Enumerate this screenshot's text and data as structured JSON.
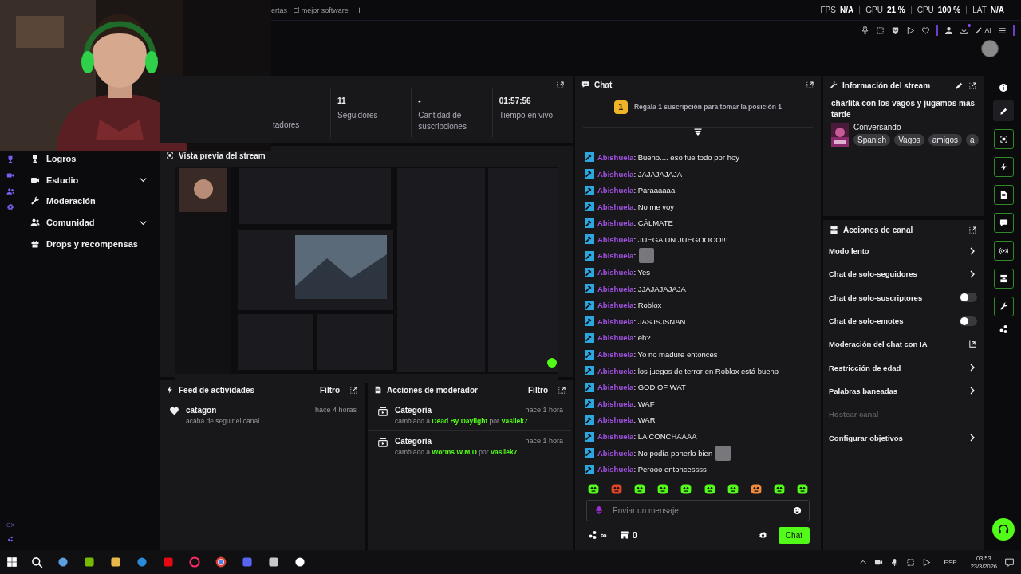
{
  "browser": {
    "tab_title": "ertas | El mejor software",
    "new_tab": "+"
  },
  "perf": [
    {
      "label": "FPS",
      "value": "N/A"
    },
    {
      "label": "GPU",
      "value": "21 %"
    },
    {
      "label": "CPU",
      "value": "100 %"
    },
    {
      "label": "LAT",
      "value": "N/A"
    }
  ],
  "toolbar": {
    "ai_label": "AI"
  },
  "left_nav": {
    "items": [
      {
        "label": "Logros",
        "expandable": false
      },
      {
        "label": "Estudio",
        "expandable": true
      },
      {
        "label": "Moderación",
        "expandable": false
      },
      {
        "label": "Comunidad",
        "expandable": true
      },
      {
        "label": "Drops y recompensas",
        "expandable": false
      }
    ],
    "footer_label": "GX"
  },
  "stats": [
    {
      "label": "tadores"
    },
    {
      "value": "11",
      "label": "Seguidores"
    },
    {
      "value": "-",
      "label": "Cantidad de suscripciones"
    },
    {
      "value": "01:57:56",
      "label": "Tiempo en vivo"
    }
  ],
  "preview": {
    "title": "Vista previa del stream"
  },
  "activity_feed": {
    "title": "Feed de actividades",
    "filter": "Filtro",
    "items": [
      {
        "user": "catagon",
        "time": "hace 4 horas",
        "detail": "acaba de seguir el canal"
      }
    ]
  },
  "mod_actions": {
    "title": "Acciones de moderador",
    "filter": "Filtro",
    "items": [
      {
        "title": "Categoría",
        "time": "hace 1 hora",
        "detail": "cambiado a **Dead By Daylight** por **Vasilek7**"
      },
      {
        "title": "Categoría",
        "time": "hace 1 hora",
        "detail": "cambiado a **Worms W.M.D** por **Vasilek7**"
      }
    ]
  },
  "chat": {
    "title": "Chat",
    "banner_rank": "1",
    "banner": "Regala 1 suscripción para tomar la posición 1",
    "messages": [
      {
        "user": "Abishuela",
        "text": ": Bueno.... eso fue todo por hoy",
        "emote": false
      },
      {
        "user": "Abishuela",
        "text": ": JAJAJAJAJA",
        "emote": false
      },
      {
        "user": "Abishuela",
        "text": ": Paraaaaaa",
        "emote": false
      },
      {
        "user": "Abishuela",
        "text": ": No me voy",
        "emote": false
      },
      {
        "user": "Abishuela",
        "text": ": CÁLMATE",
        "emote": false
      },
      {
        "user": "Abishuela",
        "text": ": JUEGA UN JUEGOOOO!!!",
        "emote": false
      },
      {
        "user": "Abishuela",
        "text": ":",
        "emote": true
      },
      {
        "user": "Abishuela",
        "text": ": Yes",
        "emote": false
      },
      {
        "user": "Abishuela",
        "text": ": JJAJAJAJAJA",
        "emote": false
      },
      {
        "user": "Abishuela",
        "text": ": Roblox",
        "emote": false
      },
      {
        "user": "Abishuela",
        "text": ": JASJSJSNAN",
        "emote": false
      },
      {
        "user": "Abishuela",
        "text": ": eh?",
        "emote": false
      },
      {
        "user": "Abishuela",
        "text": ": Yo no madure entonces",
        "emote": false
      },
      {
        "user": "Abishuela",
        "text": ": los juegos de terror en Roblox está bueno",
        "emote": false
      },
      {
        "user": "Abishuela",
        "text": ": GOD OF WAT",
        "emote": false
      },
      {
        "user": "Abishuela",
        "text": ": WAF",
        "emote": false
      },
      {
        "user": "Abishuela",
        "text": ": WAR",
        "emote": false
      },
      {
        "user": "Abishuela",
        "text": ": LA CONCHAAAA",
        "emote": false
      },
      {
        "user": "Abishuela",
        "text": ": No podía ponerlo bien",
        "emote": true
      },
      {
        "user": "Abishuela",
        "text": ": Perooo entoncessss",
        "emote": false
      }
    ],
    "input_placeholder": "Enviar un mensaje",
    "points": "∞",
    "store_count": "0",
    "send": "Chat"
  },
  "stream_info": {
    "title": "Información del stream",
    "stream_title": "charlita con los vagos y jugamos mas tarde",
    "category": "Conversando",
    "tags": [
      "Spanish",
      "Vagos",
      "amigos",
      "a"
    ]
  },
  "channel_actions": {
    "title": "Acciones de canal",
    "items": [
      {
        "label": "Modo lento",
        "kind": "chevron",
        "disabled": false
      },
      {
        "label": "Chat de solo-seguidores",
        "kind": "chevron",
        "disabled": false
      },
      {
        "label": "Chat de solo-suscriptores",
        "kind": "toggle",
        "on": false,
        "disabled": false
      },
      {
        "label": "Chat de solo-emotes",
        "kind": "toggle",
        "on": false,
        "disabled": false
      },
      {
        "label": "Moderación del chat con IA",
        "kind": "external",
        "disabled": false
      },
      {
        "label": "Restricción de edad",
        "kind": "chevron",
        "disabled": false
      },
      {
        "label": "Palabras baneadas",
        "kind": "chevron",
        "disabled": false
      },
      {
        "label": "Hostear canal",
        "kind": "plain",
        "disabled": true
      },
      {
        "label": "Configurar objetivos",
        "kind": "chevron",
        "disabled": false
      }
    ]
  },
  "taskbar": {
    "language": "ESP",
    "time": "03:53",
    "date": "23/3/2026"
  }
}
